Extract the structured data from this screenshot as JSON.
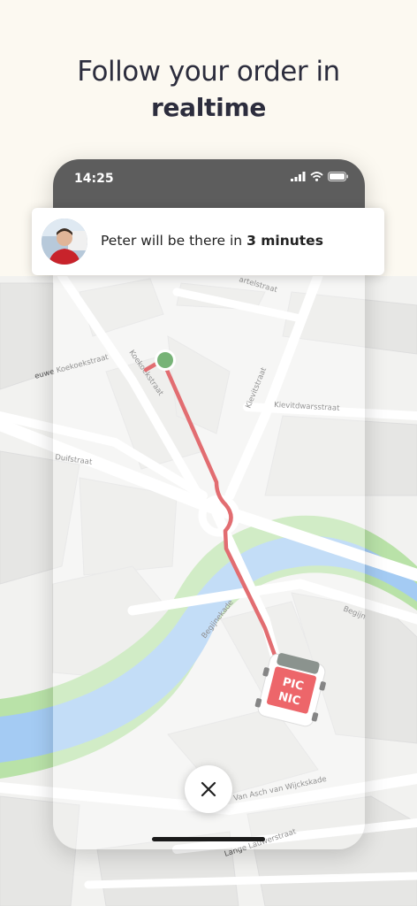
{
  "headline": {
    "line1": "Follow your order in",
    "line2": "realtime"
  },
  "status_bar": {
    "time": "14:25"
  },
  "delivery_card": {
    "prefix": "Peter will be there in ",
    "eta": "3 minutes"
  },
  "truck": {
    "logo_line1": "PIC",
    "logo_line2": "NIC"
  },
  "map": {
    "streets": {
      "kartelstraat": "artelstraat",
      "nieuwe_koekoekstraat": "euwe Koekoekstraat",
      "koekoekstraat": "Koekoekstraat",
      "kievitstraat": "Kievitstraat",
      "kievitdwarsstraat": "Kievitdwarsstraat",
      "duifstraat": "Duifstraat",
      "begijnekade": "Begijnekade",
      "begijn_right": "Begijn",
      "van_asch": "Van Asch van Wijckskade",
      "lange_lauwerstraat": "Lange Lauwerstraat"
    }
  },
  "colors": {
    "route": "#d31f26",
    "destination": "#2e8b2e",
    "water": "#a4cbf3",
    "park": "#b9e2a8",
    "brand_red": "#e3151b"
  }
}
